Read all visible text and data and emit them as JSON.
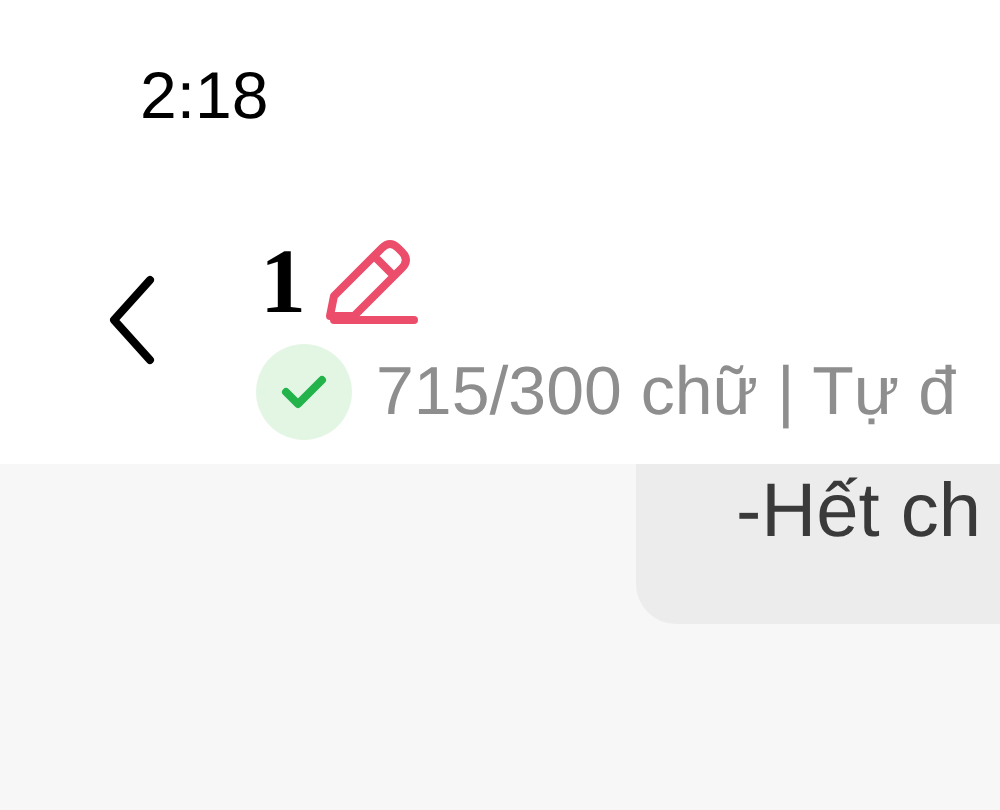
{
  "status_bar": {
    "time": "2:18"
  },
  "header": {
    "title": "1",
    "word_count": "715/300 chữ | Tự đ",
    "saved": true
  },
  "note": {
    "text": "-Hết ch"
  }
}
